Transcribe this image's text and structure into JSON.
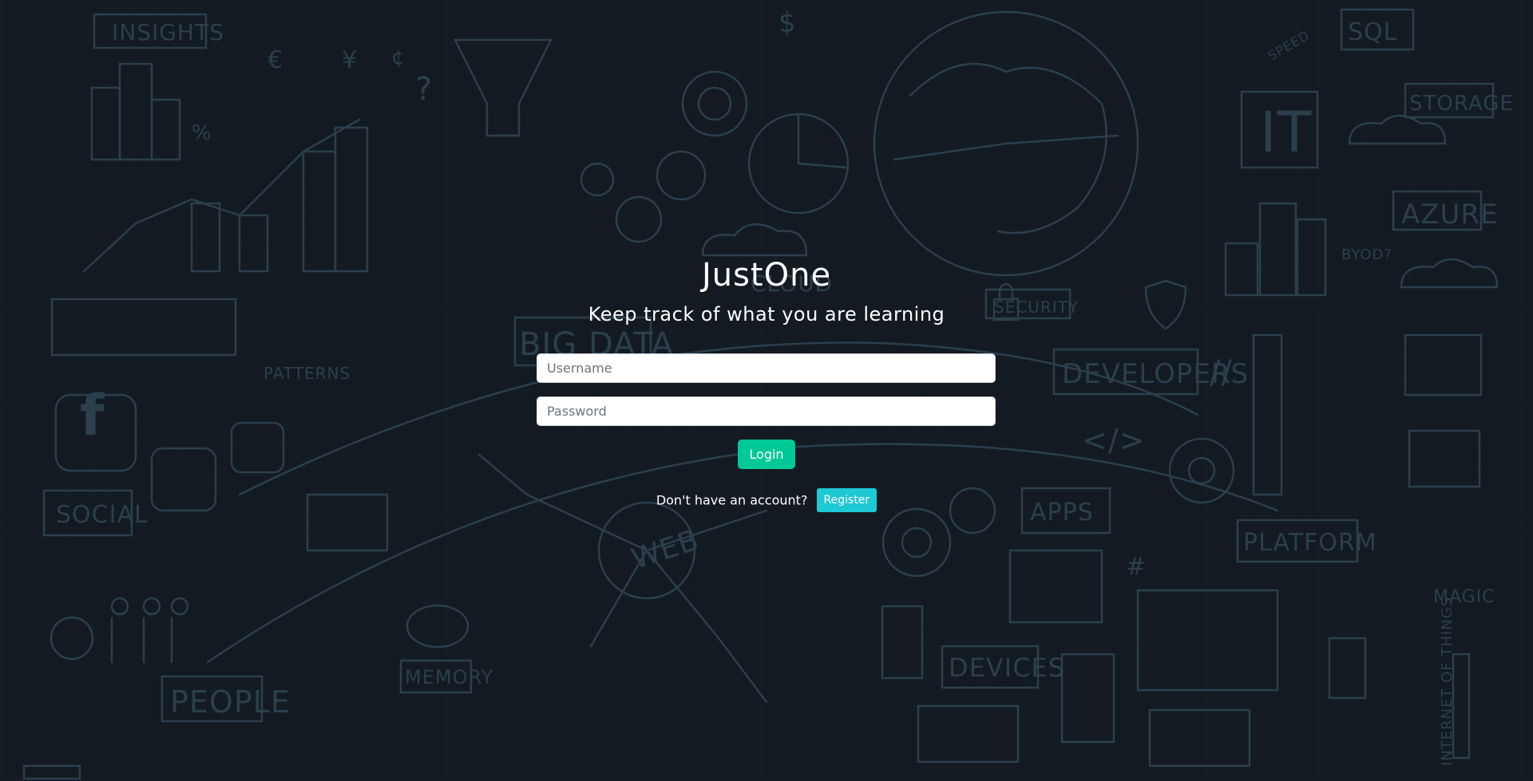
{
  "app": {
    "title": "JustOne",
    "subtitle": "Keep track of what you are learning"
  },
  "form": {
    "username_placeholder": "Username",
    "password_placeholder": "Password",
    "login_label": "Login"
  },
  "register": {
    "prompt": "Don't have an account?",
    "button_label": "Register"
  },
  "background": {
    "labels": [
      "INSIGHTS",
      "SQL",
      "STORAGE",
      "IT",
      "AZURE",
      "BYOD?",
      "SECURITY",
      "BIG DATA",
      "CLOUD",
      "PATTERNS",
      "DEVELOPERS",
      "SOCIAL",
      "APPS",
      "WEB",
      "PLATFORM",
      "MAGIC",
      "MEMORY",
      "PEOPLE",
      "DEVICES",
      "INTERNET OF THINGS",
      "SPEED"
    ],
    "colors": {
      "base": "#141c24",
      "doodle": "#3a5565",
      "login_button": "#00c896",
      "register_button": "#1ec8d4"
    }
  }
}
